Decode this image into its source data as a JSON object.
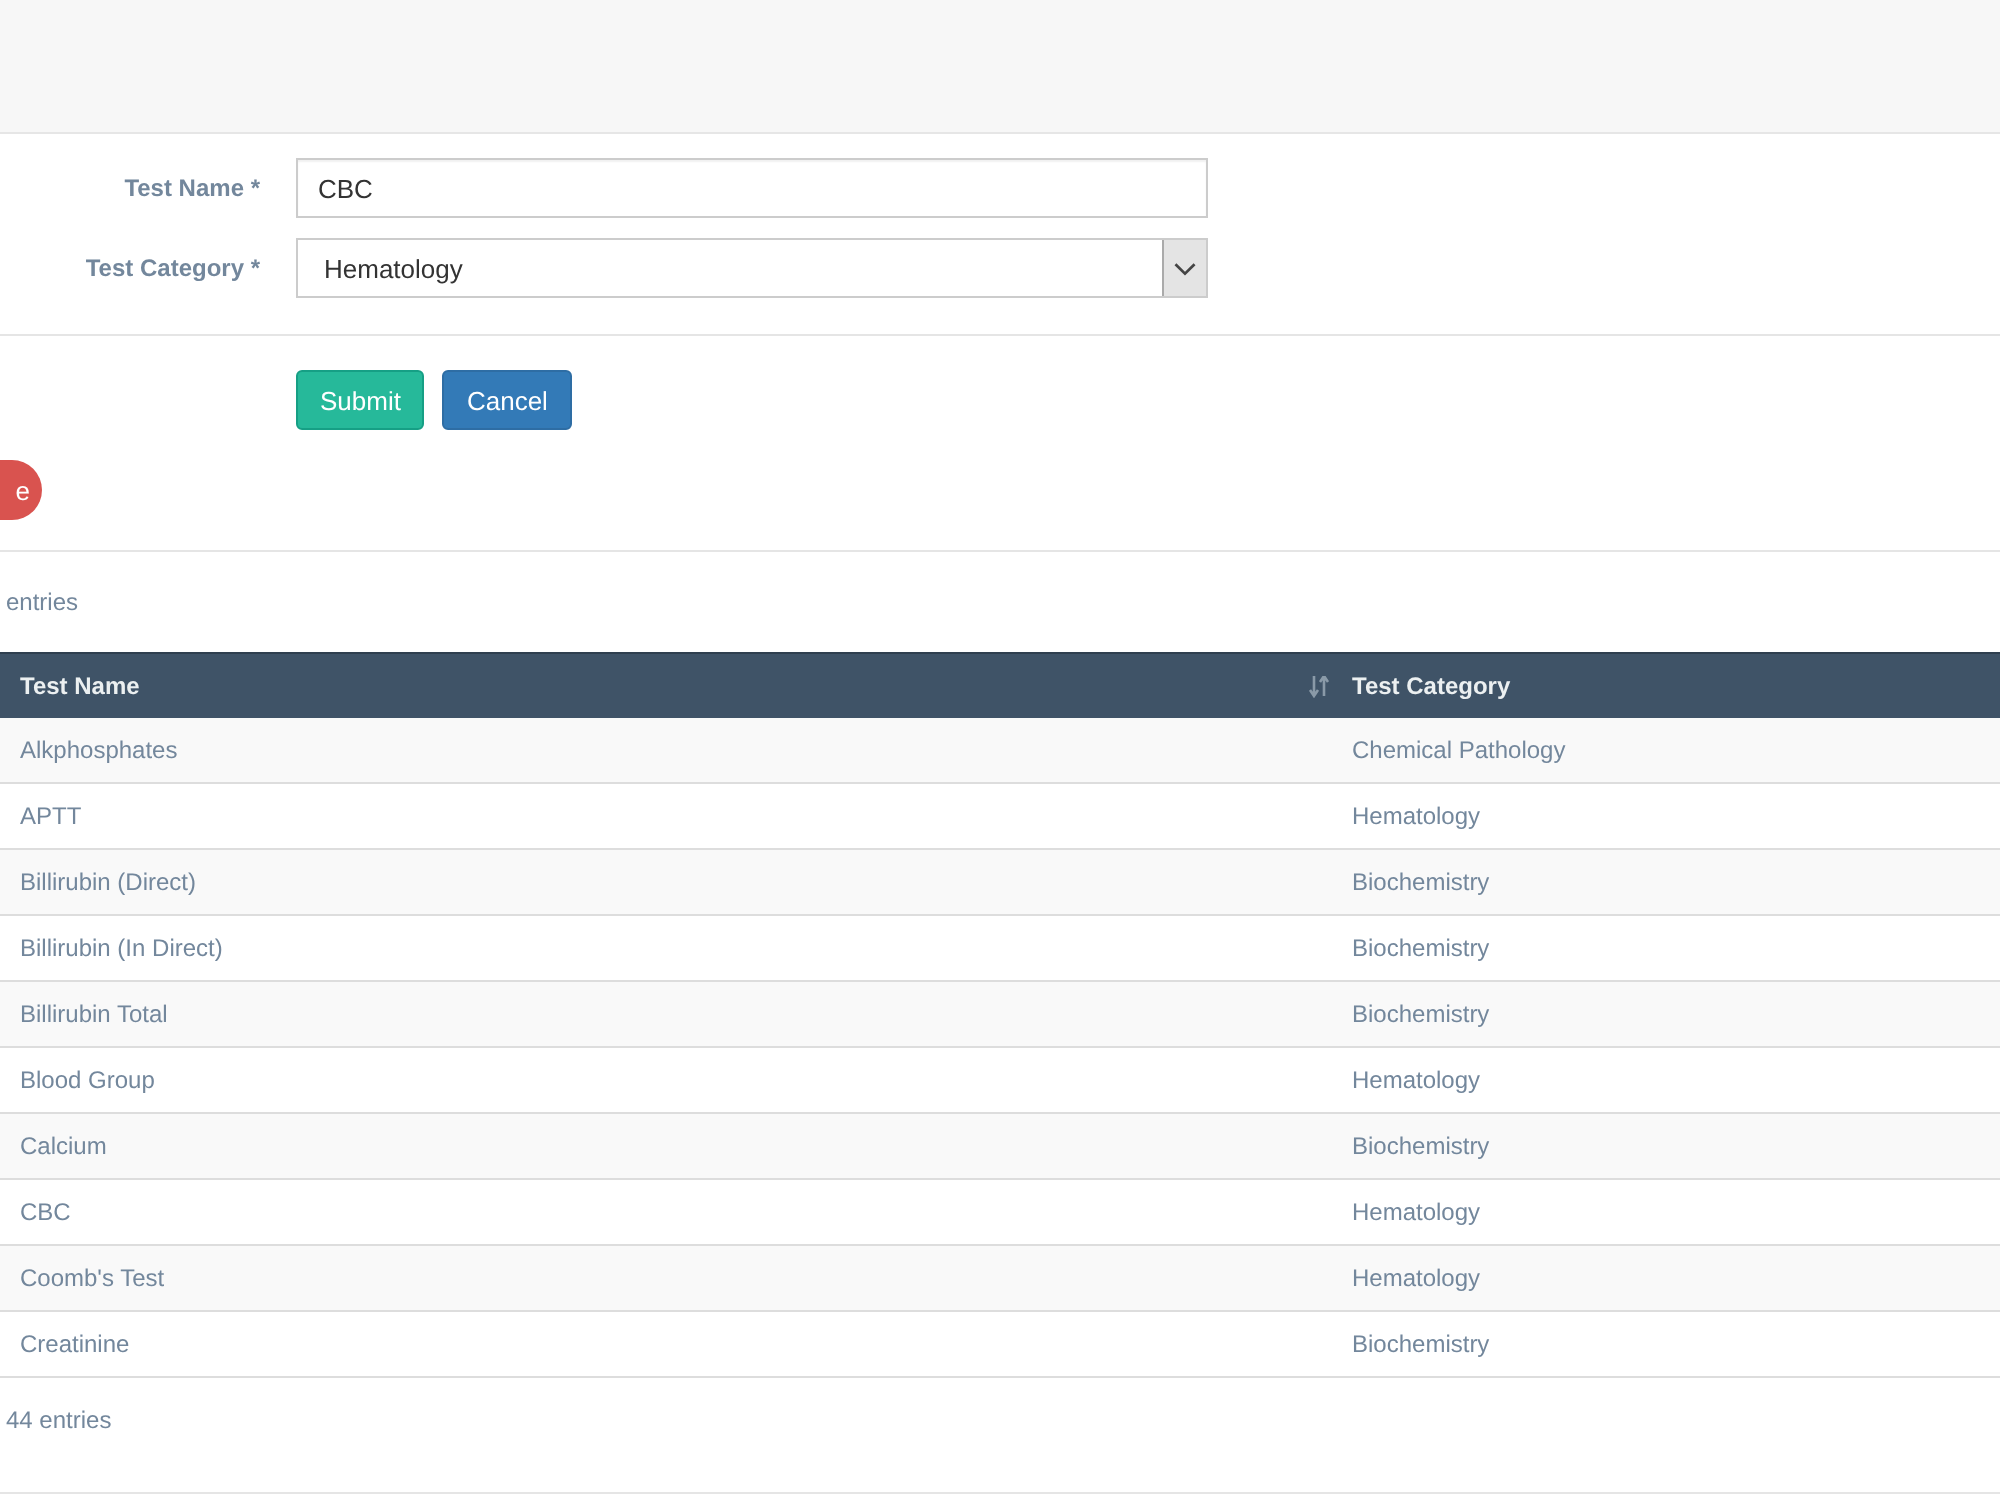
{
  "form": {
    "fields": [
      {
        "kind": "text",
        "label": "Test Name *",
        "value": "CBC"
      },
      {
        "kind": "select",
        "label": "Test Category *",
        "value": "Hematology"
      }
    ],
    "buttons": [
      {
        "kind": "submit",
        "label": "Submit"
      },
      {
        "kind": "cancel",
        "label": "Cancel"
      }
    ]
  },
  "action_button": {
    "label": "e"
  },
  "length_info": "entries",
  "table": {
    "columns": [
      {
        "label": "Test Name",
        "sort_icon": true
      },
      {
        "label": "Test Category"
      }
    ],
    "rows": [
      [
        "Alkphosphates",
        "Chemical Pathology"
      ],
      [
        "APTT",
        "Hematology"
      ],
      [
        "Billirubin (Direct)",
        "Biochemistry"
      ],
      [
        "Billirubin (In Direct)",
        "Biochemistry"
      ],
      [
        "Billirubin Total",
        "Biochemistry"
      ],
      [
        "Blood Group",
        "Hematology"
      ],
      [
        "Calcium",
        "Biochemistry"
      ],
      [
        "CBC",
        "Hematology"
      ],
      [
        "Coomb's Test",
        "Hematology"
      ],
      [
        "Creatinine",
        "Biochemistry"
      ]
    ]
  },
  "footer_info": "44 entries"
}
